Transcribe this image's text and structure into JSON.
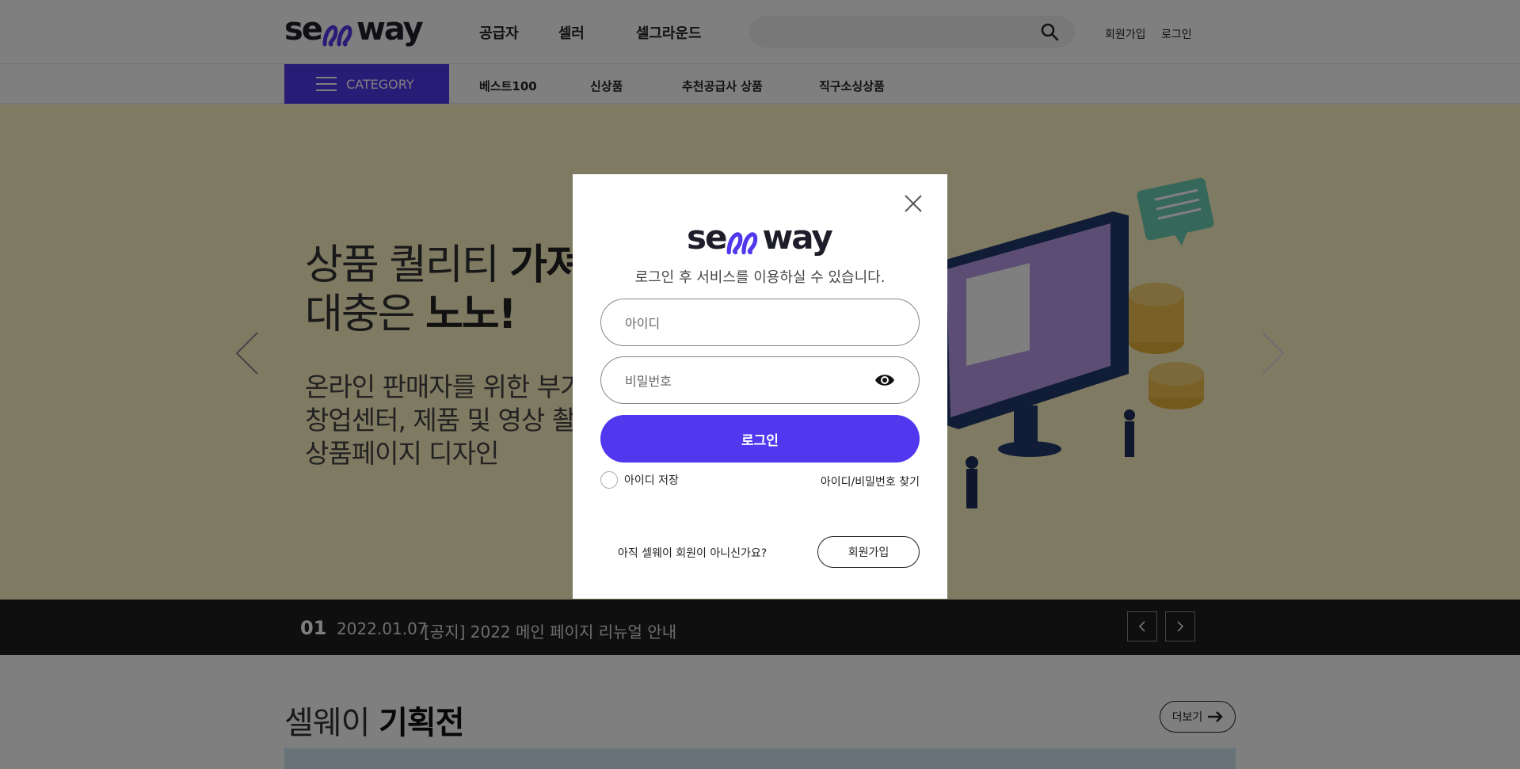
{
  "colors": {
    "brand": "#5138ee",
    "dark": "#1e1e2a",
    "hero_bg": "#fff5c4",
    "ticker_bg": "#1e1e1e"
  },
  "header": {
    "logo": {
      "left": "se",
      "right": "way"
    },
    "nav": [
      "공급자",
      "셀러",
      "셀그라운드"
    ],
    "search_placeholder": "",
    "signup": "회원가입",
    "login": "로그인"
  },
  "subnav": {
    "category": "CATEGORY",
    "items": [
      "베스트100",
      "신상품",
      "추천공급사 상품",
      "직구소싱상품"
    ]
  },
  "hero": {
    "line1_a": "상품 퀄리티 ",
    "line1_b": "가져",
    "line2_a": "대충은 ",
    "line2_b": "노노!",
    "p1": "온라인 판매자를 위한 부가",
    "p2": "창업센터, 제품 및 영상 촬영",
    "p3": "상품페이지 디자인"
  },
  "ticker": {
    "num": "01",
    "date": "2022.01.07",
    "text": "[공지] 2022 메인 페이지 리뉴얼 안내",
    "prev_icon": "chevron-left-icon",
    "next_icon": "chevron-right-icon"
  },
  "section": {
    "title_a": "셀웨이 ",
    "title_b": "기획전",
    "more": "더보기"
  },
  "modal": {
    "message": "로그인 후 서비스를 이용하실 수 있습니다.",
    "id_placeholder": "아이디",
    "pw_placeholder": "비밀번호",
    "login_button": "로그인",
    "save_id": "아이디 저장",
    "find": "아이디/비밀번호 찾기",
    "join_question": "아직 셀웨이 회원이 아니신가요?",
    "join_button": "회원가입"
  }
}
